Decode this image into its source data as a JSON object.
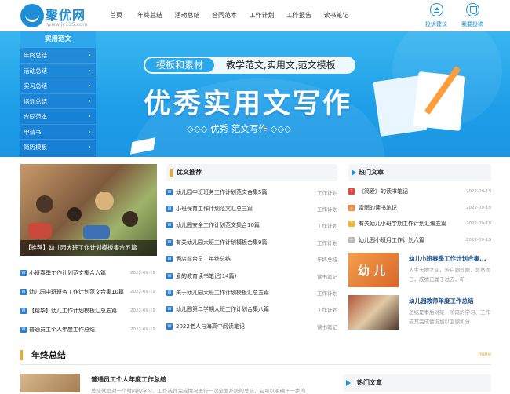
{
  "header": {
    "logo_text": "聚优网",
    "logo_sub": "www.jy135.com",
    "nav": [
      "首页",
      "年终总结",
      "活动总结",
      "合同范本",
      "工作计划",
      "工作报告",
      "读书笔记"
    ],
    "btn_feedback": "投诉建议",
    "btn_report": "我要投稿"
  },
  "banner": {
    "pill_left": "模板和素材",
    "pill_right": "教学范文,实用文,范文模板",
    "headline": "优秀实用文写作",
    "tagline": "◇◇◇ 优秀   范文写作 ◇◇◇"
  },
  "leftmenu": {
    "title": "实用范文",
    "items": [
      "年终总结",
      "活动总结",
      "实习总结",
      "培训总结",
      "合同范本",
      "申请书",
      "简历模板"
    ]
  },
  "featured": {
    "caption": "【推荐】幼儿园大班工作计划模板集合五篇"
  },
  "left_list": [
    {
      "title": "小班春季工作计划范文集合六篇",
      "date": "2022-09-19"
    },
    {
      "title": "幼儿园中班班务工作计划范文合集10篇",
      "date": "2022-09-19"
    },
    {
      "title": "【精华】幼儿工作计划模板汇总五篇",
      "date": "2022-09-19"
    },
    {
      "title": "普通员工个人年度工作总结",
      "date": "2022-09-19"
    }
  ],
  "middle": {
    "heading": "优文推荐",
    "items": [
      {
        "title": "幼儿园中班班务工作计划范文合集5篇",
        "cat": "工作计划"
      },
      {
        "title": "小班保育工作计划范文汇总三篇",
        "cat": "工作计划"
      },
      {
        "title": "幼儿园安全工作计划范文集合10篇",
        "cat": "工作计划"
      },
      {
        "title": "有关幼儿园大班工作计划模板合集9篇",
        "cat": "工作计划"
      },
      {
        "title": "酒店前台员工年终总结",
        "cat": "年终总结"
      },
      {
        "title": "爱的教育读书笔记(14篇)",
        "cat": "读书笔记"
      },
      {
        "title": "关于幼儿园大班工作计划模板汇总五篇",
        "cat": "工作计划"
      },
      {
        "title": "幼儿园第二学期大班工作计划合集八篇",
        "cat": "工作计划"
      },
      {
        "title": "2022老人与海高中阅读笔记",
        "cat": "读书笔记"
      }
    ]
  },
  "hot": {
    "heading": "热门文章",
    "items": [
      {
        "n": "1",
        "title": "《简爱》的读书笔记",
        "date": "2022-09-19"
      },
      {
        "n": "2",
        "title": "雷雨的读书笔记",
        "date": "2022-09-19"
      },
      {
        "n": "3",
        "title": "有关幼儿小班学期工作计划汇编五篇",
        "date": "2022-09-19"
      },
      {
        "n": "4",
        "title": "幼儿园小班月工作计划六篇",
        "date": "2022-09-19"
      }
    ],
    "cards": [
      {
        "title": "幼儿小班春季工作计划合集...",
        "summary": "人生天地之间，若白驹过隙，忽然而已，成绩已属于过去，新一",
        "img_text": "幼 儿"
      },
      {
        "title": "幼儿园教师年度工作总结",
        "summary": "总结是事后对某一阶段的学习、工作或其完成情况加以回顾和分"
      }
    ]
  },
  "bottom": {
    "heading": "年终总结",
    "more": "more",
    "article_title": "普通员工个人年度工作总结",
    "article_summary": "总结就是对一个时间的学习、工作或其完成情况进行一次全面系统的总结，它可以明确下一步的",
    "hot_heading": "热门文章"
  },
  "colors": {
    "brand": "#1e8fd6",
    "accent": "#f5a623"
  }
}
